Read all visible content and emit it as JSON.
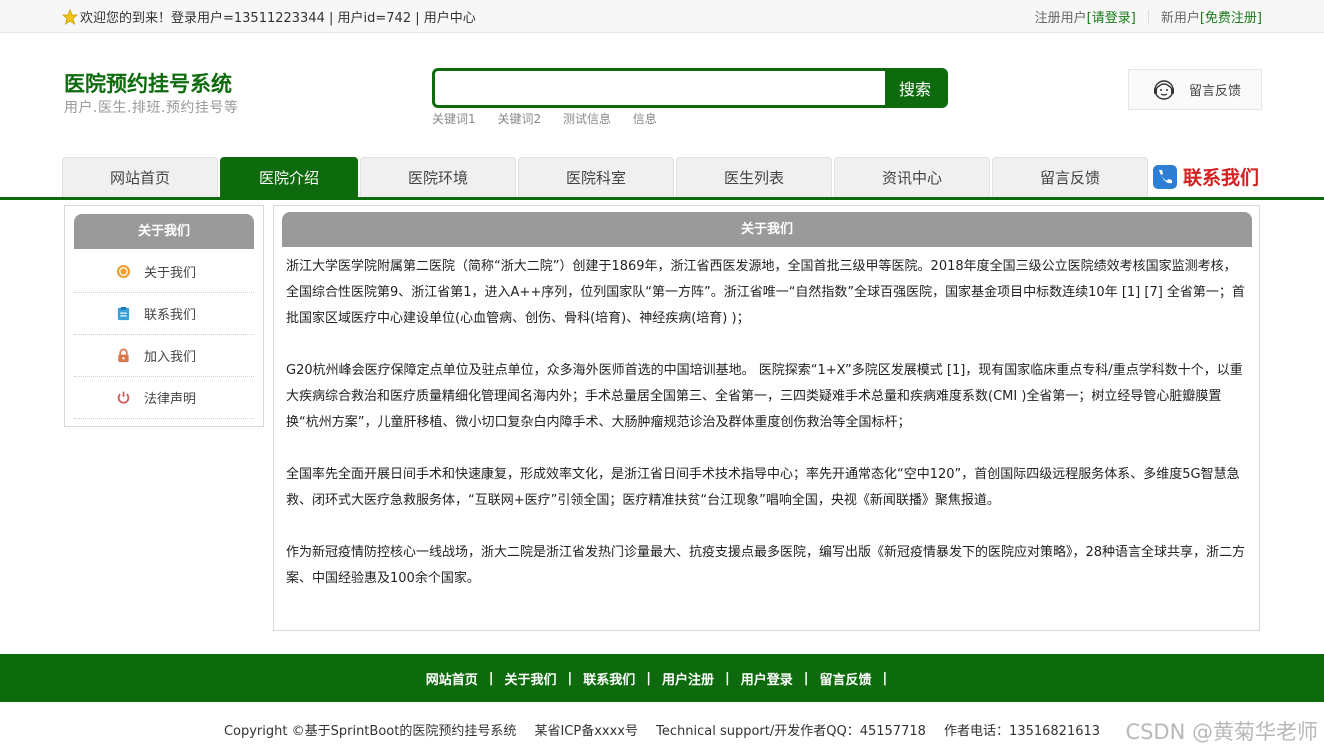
{
  "topbar": {
    "welcome": "欢迎您的到来！登录用户=13511223344 | 用户id=742 | 用户中心",
    "registered_label": "注册用户",
    "login_link": "[请登录]",
    "new_user_label": "新用户",
    "register_link": "[免费注册]"
  },
  "header": {
    "title": "医院预约挂号系统",
    "subtitle": "用户.医生.排班.预约挂号等",
    "search_placeholder": "",
    "search_button": "搜索",
    "keywords": [
      "关键词1",
      "关键词2",
      "测试信息",
      "信息"
    ],
    "feedback_label": "留言反馈"
  },
  "nav": {
    "items": [
      "网站首页",
      "医院介绍",
      "医院环境",
      "医院科室",
      "医生列表",
      "资讯中心",
      "留言反馈"
    ],
    "active_index": 1,
    "contact_label": "联系我们"
  },
  "sidebar": {
    "title": "关于我们",
    "items": [
      {
        "label": "关于我们",
        "icon": "coin-icon",
        "color": "#f0a030"
      },
      {
        "label": "联系我们",
        "icon": "clipboard-icon",
        "color": "#3aa0d8"
      },
      {
        "label": "加入我们",
        "icon": "lock-icon",
        "color": "#d9774a"
      },
      {
        "label": "法律声明",
        "icon": "power-icon",
        "color": "#d06060"
      }
    ]
  },
  "content": {
    "title": "关于我们",
    "paragraphs": [
      "浙江大学医学院附属第二医院（简称“浙大二院”）创建于1869年，浙江省西医发源地，全国首批三级甲等医院。2018年度全国三级公立医院绩效考核国家监测考核，全国综合性医院第9、浙江省第1，进入A++序列，位列国家队“第一方阵”。浙江省唯一“自然指数”全球百强医院，国家基金项目中标数连续10年 [1] [7] 全省第一；首批国家区域医疗中心建设单位(心血管病、创伤、骨科(培育)、神经疾病(培育) )；",
      "G20杭州峰会医疗保障定点单位及驻点单位，众多海外医师首选的中国培训基地。 医院探索“1+X”多院区发展模式 [1]，现有国家临床重点专科/重点学科数十个，以重大疾病综合救治和医疗质量精细化管理闻名海内外；手术总量居全国第三、全省第一，三四类疑难手术总量和疾病难度系数(CMI )全省第一；树立经导管心脏瓣膜置换“杭州方案”，儿童肝移植、微小切口复杂白内障手术、大肠肿瘤规范诊治及群体重度创伤救治等全国标杆；",
      "全国率先全面开展日间手术和快速康复，形成效率文化，是浙江省日间手术技术指导中心；率先开通常态化“空中120”，首创国际四级远程服务体系、多维度5G智慧急救、闭环式大医疗急救服务体，“互联网+医疗”引领全国；医疗精准扶贫“台江现象”唱响全国，央视《新闻联播》聚焦报道。",
      " 作为新冠疫情防控核心一线战场，浙大二院是浙江省发热门诊量最大、抗疫支援点最多医院，编写出版《新冠疫情暴发下的医院应对策略》，28种语言全球共享，浙二方案、中国经验惠及100余个国家。"
    ]
  },
  "footer": {
    "links": [
      "网站首页",
      "关于我们",
      "联系我们",
      "用户注册",
      "用户登录",
      "留言反馈"
    ],
    "separator": "|",
    "copyright": "Copyright ©基于SprintBoot的医院预约挂号系统",
    "icp": "某省ICP备xxxx号",
    "support": "Technical support/开发作者QQ：45157718",
    "phone": "作者电话：13516821613",
    "watermark": "CSDN @黄菊华老师"
  },
  "colors": {
    "brand_green": "#0d6b0d",
    "panel_gray": "#9a9a9a",
    "contact_red": "#d42020"
  }
}
